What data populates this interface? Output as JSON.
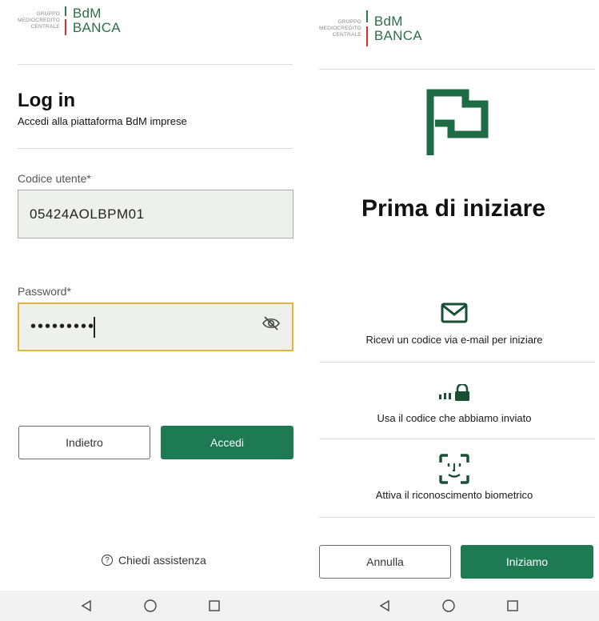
{
  "logo": {
    "small_line1": "GRUPPO",
    "small_line2": "MEDIOCREDITO",
    "small_line3": "CENTRALE",
    "big_line1": "BdM",
    "big_line2": "BANCA"
  },
  "login": {
    "title": "Log in",
    "subtitle": "Accedi alla piattaforma BdM imprese",
    "user_label": "Codice utente*",
    "user_value": "05424AOLBPM01",
    "password_label": "Password*",
    "password_value": "•••••••••",
    "back_button": "Indietro",
    "submit_button": "Accedi",
    "help_link": "Chiedi assistenza",
    "help_glyph": "?"
  },
  "onboarding": {
    "title": "Prima di iniziare",
    "steps": [
      {
        "icon": "envelope-icon",
        "text": "Ricevi un codice via e-mail per iniziare"
      },
      {
        "icon": "code-lock-icon",
        "text": "Usa il codice che abbiamo inviato"
      },
      {
        "icon": "face-id-icon",
        "text": "Attiva il riconoscimento biometrico"
      }
    ],
    "cancel_button": "Annulla",
    "start_button": "Iniziamo"
  },
  "colors": {
    "brand_green": "#1e7a52",
    "focus_border": "#e2b53c"
  }
}
